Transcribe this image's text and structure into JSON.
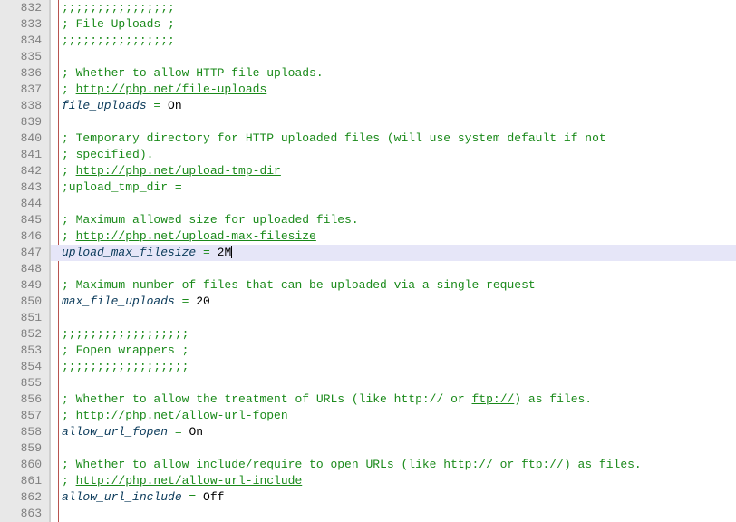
{
  "startLine": 832,
  "highlightLine": 847,
  "lines": [
    {
      "n": 832,
      "seg": [
        [
          "comment",
          ";;;;;;;;;;;;;;;;"
        ]
      ]
    },
    {
      "n": 833,
      "seg": [
        [
          "comment",
          "; File Uploads ;"
        ]
      ]
    },
    {
      "n": 834,
      "seg": [
        [
          "comment",
          ";;;;;;;;;;;;;;;;"
        ]
      ]
    },
    {
      "n": 835,
      "seg": []
    },
    {
      "n": 836,
      "seg": [
        [
          "comment",
          "; Whether to allow HTTP file uploads."
        ]
      ]
    },
    {
      "n": 837,
      "seg": [
        [
          "comment",
          "; "
        ],
        [
          "link",
          "http://php.net/file-uploads"
        ]
      ]
    },
    {
      "n": 838,
      "seg": [
        [
          "key",
          "file_uploads"
        ],
        [
          "op",
          " = "
        ],
        [
          "val",
          "On"
        ]
      ]
    },
    {
      "n": 839,
      "seg": []
    },
    {
      "n": 840,
      "seg": [
        [
          "comment",
          "; Temporary directory for HTTP uploaded files (will use system default if not"
        ]
      ]
    },
    {
      "n": 841,
      "seg": [
        [
          "comment",
          "; specified)."
        ]
      ]
    },
    {
      "n": 842,
      "seg": [
        [
          "comment",
          "; "
        ],
        [
          "link",
          "http://php.net/upload-tmp-dir"
        ]
      ]
    },
    {
      "n": 843,
      "seg": [
        [
          "comment",
          ";upload_tmp_dir ="
        ]
      ]
    },
    {
      "n": 844,
      "seg": []
    },
    {
      "n": 845,
      "seg": [
        [
          "comment",
          "; Maximum allowed size for uploaded files."
        ]
      ]
    },
    {
      "n": 846,
      "seg": [
        [
          "comment",
          "; "
        ],
        [
          "link",
          "http://php.net/upload-max-filesize"
        ]
      ]
    },
    {
      "n": 847,
      "seg": [
        [
          "key",
          "upload_max_filesize"
        ],
        [
          "op",
          " = "
        ],
        [
          "val",
          "2M"
        ]
      ],
      "caret": true
    },
    {
      "n": 848,
      "seg": []
    },
    {
      "n": 849,
      "seg": [
        [
          "comment",
          "; Maximum number of files that can be uploaded via a single request"
        ]
      ]
    },
    {
      "n": 850,
      "seg": [
        [
          "key",
          "max_file_uploads"
        ],
        [
          "op",
          " = "
        ],
        [
          "val",
          "20"
        ]
      ]
    },
    {
      "n": 851,
      "seg": []
    },
    {
      "n": 852,
      "seg": [
        [
          "comment",
          ";;;;;;;;;;;;;;;;;;"
        ]
      ]
    },
    {
      "n": 853,
      "seg": [
        [
          "comment",
          "; Fopen wrappers ;"
        ]
      ]
    },
    {
      "n": 854,
      "seg": [
        [
          "comment",
          ";;;;;;;;;;;;;;;;;;"
        ]
      ]
    },
    {
      "n": 855,
      "seg": []
    },
    {
      "n": 856,
      "seg": [
        [
          "comment",
          "; Whether to allow the treatment of URLs (like http:// or "
        ],
        [
          "link",
          "ftp://"
        ],
        [
          "comment",
          ") as files."
        ]
      ]
    },
    {
      "n": 857,
      "seg": [
        [
          "comment",
          "; "
        ],
        [
          "link",
          "http://php.net/allow-url-fopen"
        ]
      ]
    },
    {
      "n": 858,
      "seg": [
        [
          "key",
          "allow_url_fopen"
        ],
        [
          "op",
          " = "
        ],
        [
          "val",
          "On"
        ]
      ]
    },
    {
      "n": 859,
      "seg": []
    },
    {
      "n": 860,
      "seg": [
        [
          "comment",
          "; Whether to allow include/require to open URLs (like http:// or "
        ],
        [
          "link",
          "ftp://"
        ],
        [
          "comment",
          ") as files."
        ]
      ]
    },
    {
      "n": 861,
      "seg": [
        [
          "comment",
          "; "
        ],
        [
          "link",
          "http://php.net/allow-url-include"
        ]
      ]
    },
    {
      "n": 862,
      "seg": [
        [
          "key",
          "allow_url_include"
        ],
        [
          "op",
          " = "
        ],
        [
          "val",
          "Off"
        ]
      ]
    },
    {
      "n": 863,
      "seg": []
    }
  ]
}
